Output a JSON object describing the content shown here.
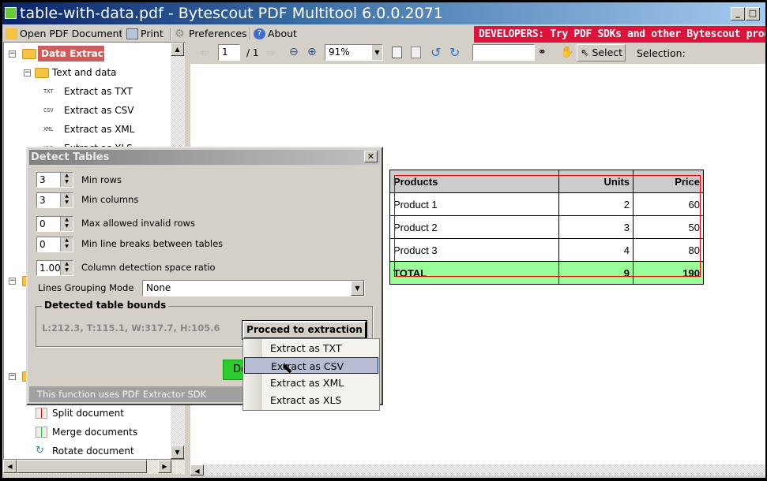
{
  "window": {
    "title": "table-with-data.pdf - Bytescout PDF Multitool 6.0.0.2071",
    "minimize": "_",
    "maximize": "□"
  },
  "menu": {
    "open": "Open PDF Document",
    "print": "Print",
    "preferences": "Preferences",
    "about": "About"
  },
  "promo": "DEVELOPERS: Try PDF SDKs and other Bytescout products",
  "tree": {
    "root": "Data Extraction",
    "group": "Text and data",
    "items": [
      {
        "tag": "TXT",
        "label": "Extract as TXT"
      },
      {
        "tag": "CSV",
        "label": "Extract as CSV"
      },
      {
        "tag": "XML",
        "label": "Extract as XML"
      },
      {
        "tag": "XLS",
        "label": "Extract as XLS"
      }
    ],
    "doc_items": [
      "Split document",
      "Merge documents",
      "Rotate document"
    ]
  },
  "toolbar": {
    "page": "1",
    "page_total": "/ 1",
    "zoom": "91%",
    "search": "",
    "select": "Select",
    "selection_label": "Selection:"
  },
  "pdf_table": {
    "headers": [
      "Products",
      "Units",
      "Price"
    ],
    "rows": [
      [
        "Product 1",
        "2",
        "60"
      ],
      [
        "Product 2",
        "3",
        "50"
      ],
      [
        "Product 3",
        "4",
        "80"
      ]
    ],
    "total": [
      "TOTAL",
      "9",
      "190"
    ]
  },
  "dialog": {
    "title": "Detect Tables",
    "close": "✕",
    "fields": [
      {
        "value": "3",
        "label": "Min rows"
      },
      {
        "value": "3",
        "label": "Min columns"
      },
      {
        "value": "0",
        "label": "Max allowed invalid rows"
      },
      {
        "value": "0",
        "label": "Min line breaks between tables"
      },
      {
        "value": "1.00",
        "label": "Column detection space ratio"
      }
    ],
    "grouping_label": "Lines Grouping Mode",
    "grouping_value": "None",
    "bounds_title": "Detected table bounds",
    "bounds_value": "L:212.3, T:115.1, W:317.7, H:105.6",
    "proceed": "Proceed to extraction",
    "detect_partial": "De",
    "footer": "This function uses PDF Extractor SDK"
  },
  "popup": {
    "items": [
      "Extract as TXT",
      "Extract as CSV",
      "Extract as XML",
      "Extract as XLS"
    ],
    "highlighted": 1
  }
}
